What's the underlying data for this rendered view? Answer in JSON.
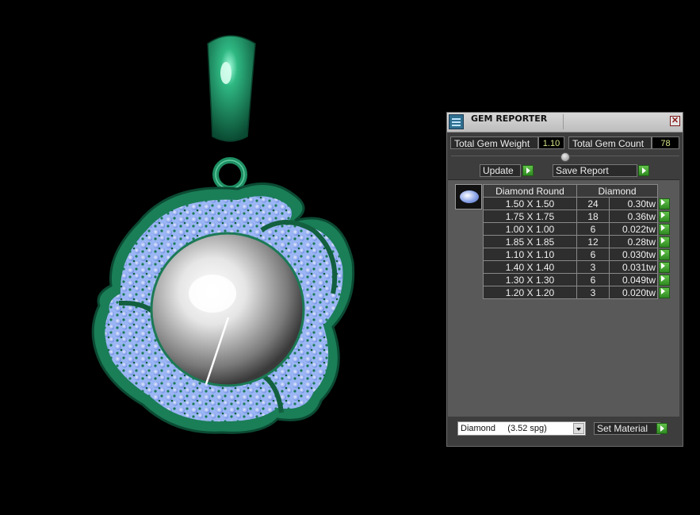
{
  "window": {
    "title": "GEM REPORTER",
    "close_glyph": "✕"
  },
  "summary": {
    "weight_label": "Total Gem Weight",
    "weight_value": "1.10",
    "count_label": "Total Gem Count",
    "count_value": "78"
  },
  "actions": {
    "update_label": "Update",
    "save_label": "Save Report"
  },
  "table": {
    "headers": [
      "Diamond Round",
      "Diamond"
    ],
    "rows": [
      {
        "size": "1.50 X 1.50",
        "count": "24",
        "weight": "0.30tw"
      },
      {
        "size": "1.75 X 1.75",
        "count": "18",
        "weight": "0.36tw"
      },
      {
        "size": "1.00 X 1.00",
        "count": "6",
        "weight": "0.022tw"
      },
      {
        "size": "1.85 X 1.85",
        "count": "12",
        "weight": "0.28tw"
      },
      {
        "size": "1.10 X 1.10",
        "count": "6",
        "weight": "0.030tw"
      },
      {
        "size": "1.40 X 1.40",
        "count": "3",
        "weight": "0.031tw"
      },
      {
        "size": "1.30 X 1.30",
        "count": "6",
        "weight": "0.049tw"
      },
      {
        "size": "1.20 X 1.20",
        "count": "3",
        "weight": "0.020tw"
      }
    ]
  },
  "material": {
    "selected": "Diamond     (3.52 spg)",
    "set_label": "Set Material"
  },
  "colors": {
    "metal": "#1f8a5e",
    "gem": "#8fb0f5",
    "play_green": "#3aa02a"
  }
}
